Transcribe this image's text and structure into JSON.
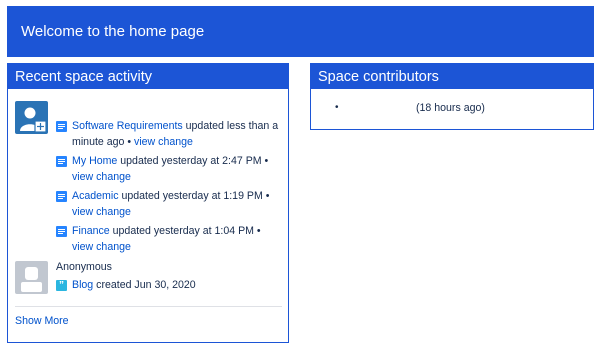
{
  "welcome": {
    "title": "Welcome to the home page"
  },
  "recent_activity": {
    "header": "Recent space activity",
    "groups": [
      {
        "avatar": "user-avatar-icon",
        "entries": [
          {
            "icon": "page-icon",
            "title": "Software Requirements",
            "action": " updated less than a minute ago • ",
            "view_change": "view change"
          },
          {
            "icon": "page-icon",
            "title": "My Home",
            "action": " updated yesterday at 2:47 PM • ",
            "view_change": "view change"
          },
          {
            "icon": "page-icon",
            "title": "Academic",
            "action": " updated yesterday at 1:19 PM • ",
            "view_change": "view change"
          },
          {
            "icon": "page-icon",
            "title": "Finance",
            "action": " updated yesterday at 1:04 PM • ",
            "view_change": "view change"
          }
        ]
      }
    ],
    "anonymous": {
      "name": "Anonymous",
      "avatar": "anonymous-avatar-icon",
      "entry": {
        "icon": "blog-icon",
        "title": "Blog",
        "action": " created Jun 30, 2020"
      }
    },
    "show_more": "Show More"
  },
  "space_contributors": {
    "header": "Space contributors",
    "items": [
      {
        "bullet": "•",
        "time": "(18 hours ago)"
      }
    ]
  },
  "colors": {
    "brand_blue": "#1c55d6",
    "link": "#0052cc",
    "text": "#172b4d",
    "page_icon": "#2684ff",
    "blog_icon": "#2bb6e0"
  }
}
